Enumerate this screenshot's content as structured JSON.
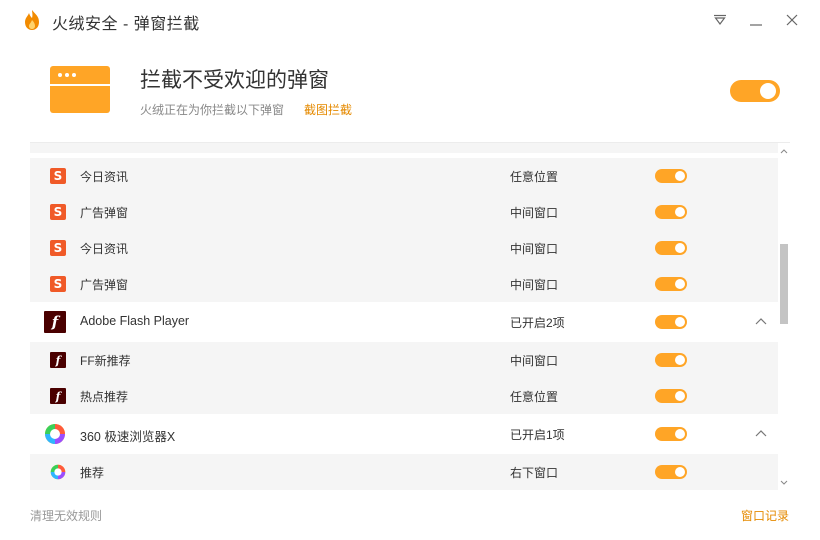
{
  "window": {
    "title": "火绒安全 - 弹窗拦截",
    "accent_color": "#ffa526"
  },
  "header": {
    "title": "拦截不受欢迎的弹窗",
    "subtitle": "火绒正在为你拦截以下弹窗",
    "screenshot_link": "截图拦截",
    "master_toggle_on": true
  },
  "list": {
    "rows": [
      {
        "type": "sub",
        "icon": "sohu-icon",
        "name": "今日资讯",
        "position": "任意位置",
        "enabled": true
      },
      {
        "type": "sub",
        "icon": "sohu-icon",
        "name": "广告弹窗",
        "position": "中间窗口",
        "enabled": true
      },
      {
        "type": "sub",
        "icon": "sohu-icon",
        "name": "今日资讯",
        "position": "中间窗口",
        "enabled": true
      },
      {
        "type": "sub",
        "icon": "sohu-icon",
        "name": "广告弹窗",
        "position": "中间窗口",
        "enabled": true
      },
      {
        "type": "group",
        "icon": "flash-player-icon",
        "name": "Adobe Flash Player",
        "position": "已开启2项",
        "enabled": true,
        "expanded": true
      },
      {
        "type": "sub",
        "icon": "flash-player-icon",
        "name": "FF新推荐",
        "position": "中间窗口",
        "enabled": true
      },
      {
        "type": "sub",
        "icon": "flash-player-icon",
        "name": "热点推荐",
        "position": "任意位置",
        "enabled": true
      },
      {
        "type": "group",
        "icon": "360-browser-icon",
        "name": "360 极速浏览器X",
        "position": "已开启1项",
        "enabled": true,
        "expanded": true
      },
      {
        "type": "sub",
        "icon": "360-browser-icon",
        "name": "推荐",
        "position": "右下窗口",
        "enabled": true
      }
    ]
  },
  "footer": {
    "clear_rules": "清理无效规则",
    "window_log": "窗口记录"
  }
}
